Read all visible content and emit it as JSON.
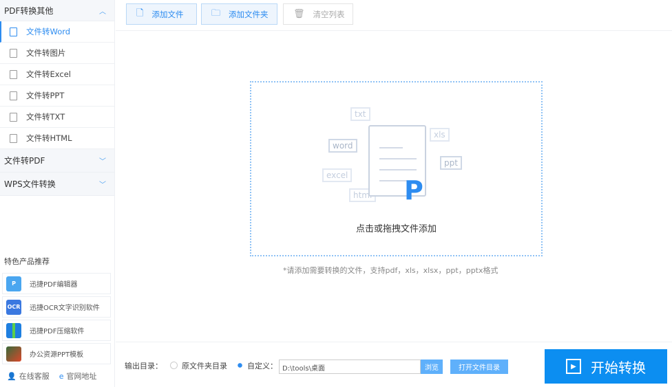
{
  "sidebar": {
    "group1": "PDF转换其他",
    "items": [
      {
        "label": "文件转Word"
      },
      {
        "label": "文件转图片"
      },
      {
        "label": "文件转Excel"
      },
      {
        "label": "文件转PPT"
      },
      {
        "label": "文件转TXT"
      },
      {
        "label": "文件转HTML"
      }
    ],
    "group2": "文件转PDF",
    "group3": "WPS文件转换",
    "featured_title": "特色产品推荐",
    "products": [
      {
        "label": "迅捷PDF编辑器",
        "icon": "P"
      },
      {
        "label": "迅捷OCR文字识别软件",
        "icon": "OCR"
      },
      {
        "label": "迅捷PDF压缩软件",
        "icon": ""
      },
      {
        "label": "办公资源PPT模板",
        "icon": ""
      }
    ],
    "online_service": "在线客服",
    "website": "官网地址"
  },
  "toolbar": {
    "add_file": "添加文件",
    "add_folder": "添加文件夹",
    "clear_list": "清空列表"
  },
  "drop": {
    "tags": [
      "txt",
      "word",
      "xls",
      "ppt",
      "excel",
      "html"
    ],
    "text": "点击或拖拽文件添加",
    "hint": "*请添加需要转换的文件，支持pdf，xls，xlsx，ppt，pptx格式"
  },
  "bottom": {
    "output_label": "输出目录：",
    "option_source": "原文件夹目录",
    "option_custom": "自定义：",
    "path": "D:\\tools\\桌面",
    "browse": "浏览",
    "open_dir": "打开文件目录",
    "start": "开始转换"
  },
  "colors": {
    "accent": "#2d8cf0",
    "start": "#0c8ef1"
  }
}
